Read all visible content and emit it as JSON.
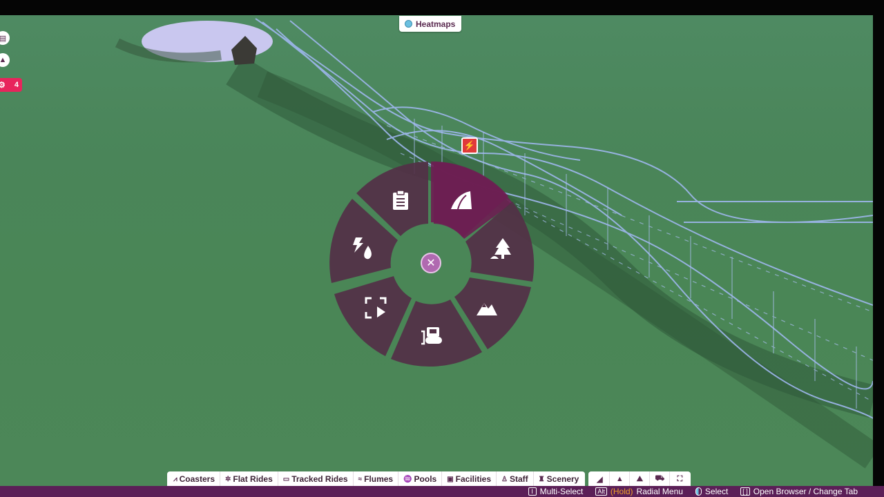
{
  "overlay": {
    "heatmaps_label": "Heatmaps",
    "alert_count": "4",
    "ride_marker_icon": "ride-broken-icon"
  },
  "radial_menu": {
    "segments": [
      {
        "icon": "clipboard-icon"
      },
      {
        "icon": "path-icon"
      },
      {
        "icon": "tree-icon"
      },
      {
        "icon": "terrain-mountain-icon"
      },
      {
        "icon": "bulldozer-icon"
      },
      {
        "icon": "blueprint-select-icon"
      },
      {
        "icon": "utilities-power-water-icon"
      }
    ],
    "close_icon": "close-icon"
  },
  "bottom_tabs": {
    "categories": [
      {
        "label": "Coasters",
        "icon": "coaster-icon"
      },
      {
        "label": "Flat Rides",
        "icon": "flat-ride-icon"
      },
      {
        "label": "Tracked Rides",
        "icon": "tracked-ride-icon"
      },
      {
        "label": "Flumes",
        "icon": "flume-icon"
      },
      {
        "label": "Pools",
        "icon": "pool-icon"
      },
      {
        "label": "Facilities",
        "icon": "facility-icon"
      },
      {
        "label": "Staff",
        "icon": "staff-icon"
      },
      {
        "label": "Scenery",
        "icon": "scenery-icon"
      }
    ],
    "tools": [
      "path-icon",
      "tree-icon",
      "terrain-mountain-icon",
      "bulldozer-icon",
      "blueprint-select-icon"
    ]
  },
  "hints": [
    {
      "key": "I",
      "label": "Multi-Select"
    },
    {
      "key": "Alt",
      "modifier": "(Hold)",
      "label": "Radial Menu"
    },
    {
      "key": "mouse-left",
      "label": "Select"
    },
    {
      "key": "[ ]",
      "label": "Open Browser / Change Tab"
    }
  ],
  "colors": {
    "radial_segment": "#533046",
    "radial_highlight": "#6d1e52",
    "accent": "#e8245c",
    "hint_bar": "#5b1f57"
  }
}
